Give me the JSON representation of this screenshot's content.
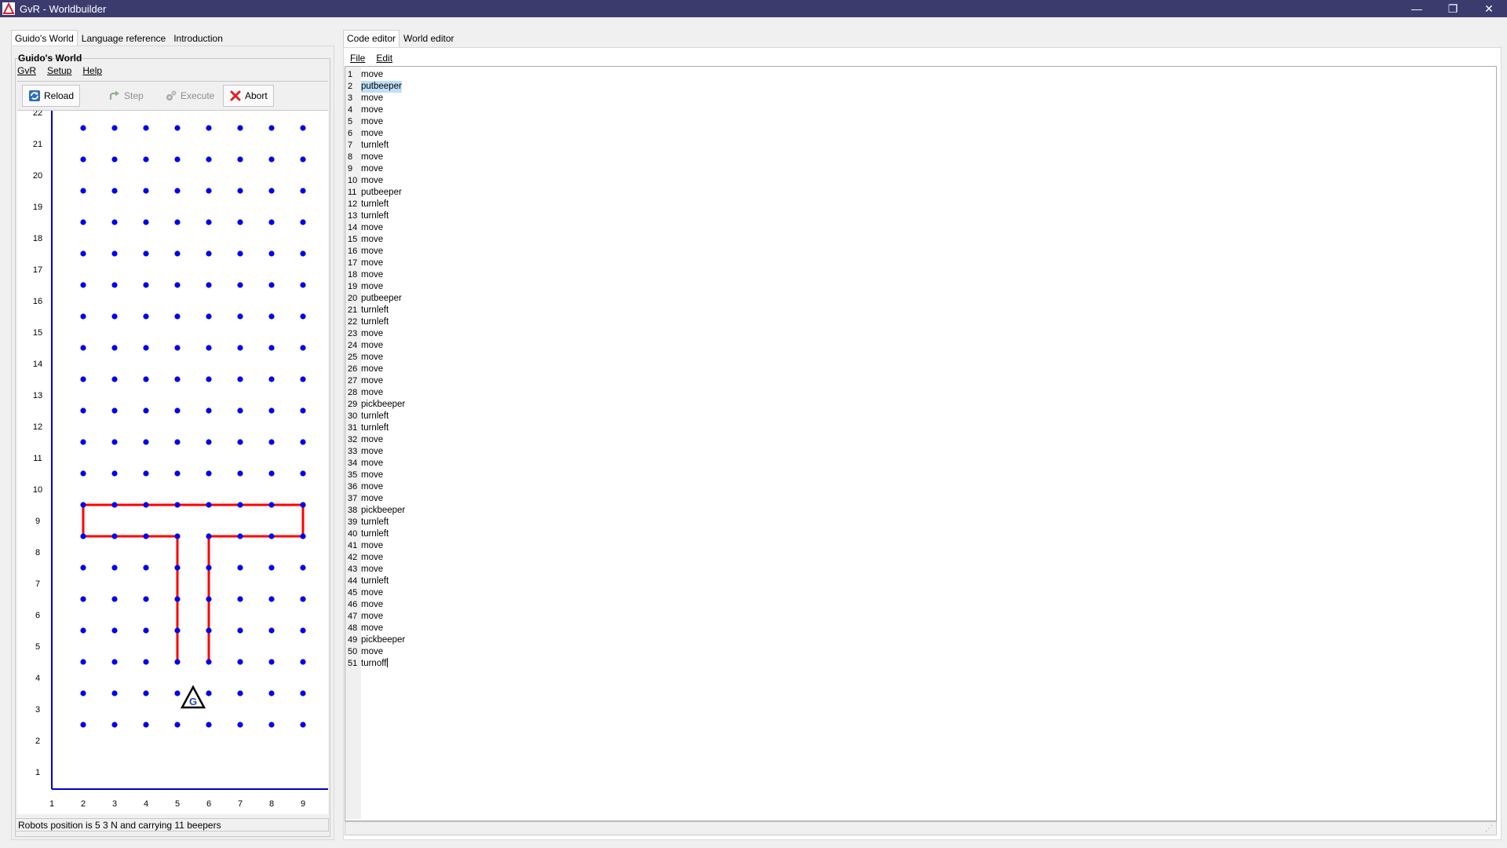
{
  "window": {
    "title": "GvR - Worldbuilder",
    "controls": [
      "minimize-icon",
      "restore-icon",
      "close-icon"
    ]
  },
  "left_tabs": [
    {
      "label": "Guido's World",
      "active": true
    },
    {
      "label": "Language reference",
      "active": false
    },
    {
      "label": "Introduction",
      "active": false
    }
  ],
  "left": {
    "group_title": "Guido's World",
    "menu": [
      "GvR",
      "Setup",
      "Help"
    ],
    "toolbar": {
      "reload": "Reload",
      "step": "Step",
      "execute": "Execute",
      "abort": "Abort"
    },
    "status": "Robots position is 5 3 N and carrying 11 beepers"
  },
  "world": {
    "x_ticks": [
      1,
      2,
      3,
      4,
      5,
      6,
      7,
      8,
      9
    ],
    "y_ticks": [
      1,
      2,
      3,
      4,
      5,
      6,
      7,
      8,
      9,
      10,
      11,
      12,
      13,
      14,
      15,
      16,
      17,
      18,
      19,
      20,
      21,
      22
    ],
    "beeper_color": "#0000ee",
    "wall_color": "#ff0000",
    "robot": {
      "x": 5,
      "y": 3,
      "direction": "N",
      "letter": "G"
    }
  },
  "right_tabs": [
    {
      "label": "Code editor",
      "active": true
    },
    {
      "label": "World editor",
      "active": false
    }
  ],
  "right": {
    "menu": [
      "File",
      "Edit"
    ],
    "selected_line": 2,
    "code": [
      "move",
      "putbeeper",
      "move",
      "move",
      "move",
      "move",
      "turnleft",
      "move",
      "move",
      "move",
      "putbeeper",
      "turnleft",
      "turnleft",
      "move",
      "move",
      "move",
      "move",
      "move",
      "move",
      "putbeeper",
      "turnleft",
      "turnleft",
      "move",
      "move",
      "move",
      "move",
      "move",
      "move",
      "pickbeeper",
      "turnleft",
      "turnleft",
      "move",
      "move",
      "move",
      "move",
      "move",
      "move",
      "pickbeeper",
      "turnleft",
      "turnleft",
      "move",
      "move",
      "move",
      "turnleft",
      "move",
      "move",
      "move",
      "move",
      "pickbeeper",
      "move",
      "turnoff"
    ]
  }
}
